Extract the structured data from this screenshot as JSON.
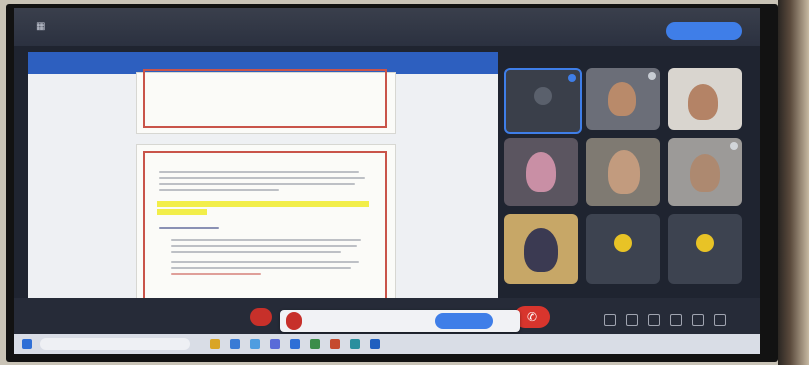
{
  "app": {
    "title": "",
    "top_button_label": ""
  },
  "bottom_bar": {
    "time": ""
  },
  "toast": {
    "message": "",
    "button": "",
    "close": ""
  },
  "taskbar": {
    "search_placeholder": "",
    "clock": ""
  },
  "participants": [
    {
      "name": "",
      "kind": "avatar-active"
    },
    {
      "name": "",
      "kind": "video"
    },
    {
      "name": "",
      "kind": "video"
    },
    {
      "name": "",
      "kind": "video"
    },
    {
      "name": "",
      "kind": "video"
    },
    {
      "name": "",
      "kind": "video"
    },
    {
      "name": "",
      "kind": "video"
    },
    {
      "name": "",
      "kind": "avatar"
    },
    {
      "name": "",
      "kind": "avatar"
    }
  ],
  "colors": {
    "accent": "#3f7ee8",
    "end_call": "#d8352d",
    "highlight": "#f2ee4a",
    "frame": "#c9544a"
  }
}
